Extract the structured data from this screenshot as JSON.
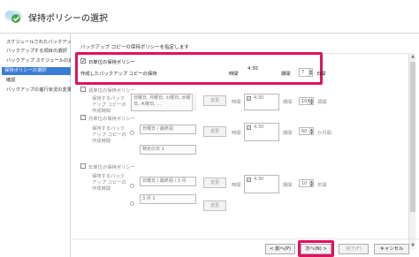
{
  "window": {
    "title": "保持ポリシーの選択"
  },
  "sidebar": {
    "items": [
      {
        "label": "スケジュールされたバックアップ..."
      },
      {
        "label": "バックアップする項目の選択"
      },
      {
        "label": "バックアップ スケジュールの選択"
      },
      {
        "label": "保持ポリシーの選択"
      },
      {
        "label": "確認"
      },
      {
        "label": "バックアップの進行状況の変更"
      }
    ]
  },
  "main": {
    "intro": "バックアップ コピーの保持ポリシーを指定します",
    "daily": {
      "label": "日単位の保持ポリシー",
      "retain_label": "作成したバックアップ コピーの保持",
      "time_label": "時間",
      "time_value": "4:30",
      "period_label": "期間",
      "period_value": "7",
      "unit": "日間"
    },
    "weekly": {
      "label": "週単位の保持ポリシー",
      "retain_label": "保持するバックアップ コピーの作成時間",
      "days": "日曜日, 月曜日, 火曜日, 水曜日, 木曜日, ...",
      "change_label": "変更",
      "time_label": "時間",
      "time_value": "4:30",
      "period_label": "期間",
      "period_value": "104",
      "unit": "週間"
    },
    "monthly": {
      "label": "月単位の保持ポリシー",
      "retain_label": "保持するバックアップ コピーの作成時間",
      "option1": "日曜日 / 最終週",
      "option2": "特定の日 1",
      "change_label": "変更",
      "time_label": "時間",
      "time_value": "4:30",
      "period_label": "期間",
      "period_value": "60",
      "unit": "か月間"
    },
    "yearly": {
      "label": "年単位の保持ポリシー",
      "retain_label": "保持するバックアップ コピーの作成時間",
      "option1": "日曜日 / 最終週 / 3 月",
      "option2": "3 月 1",
      "change_label": "変更",
      "time_label": "時間",
      "time_value": "4:30",
      "period_label": "期間",
      "period_value": "10",
      "unit": "年間"
    }
  },
  "footer": {
    "prev": "< 前へ(P)",
    "next": "次へ(N) >",
    "finish": "完了(F)",
    "cancel": "キャンセル"
  },
  "colors": {
    "highlight": "#e0115f",
    "selected": "#3a7bd5"
  }
}
